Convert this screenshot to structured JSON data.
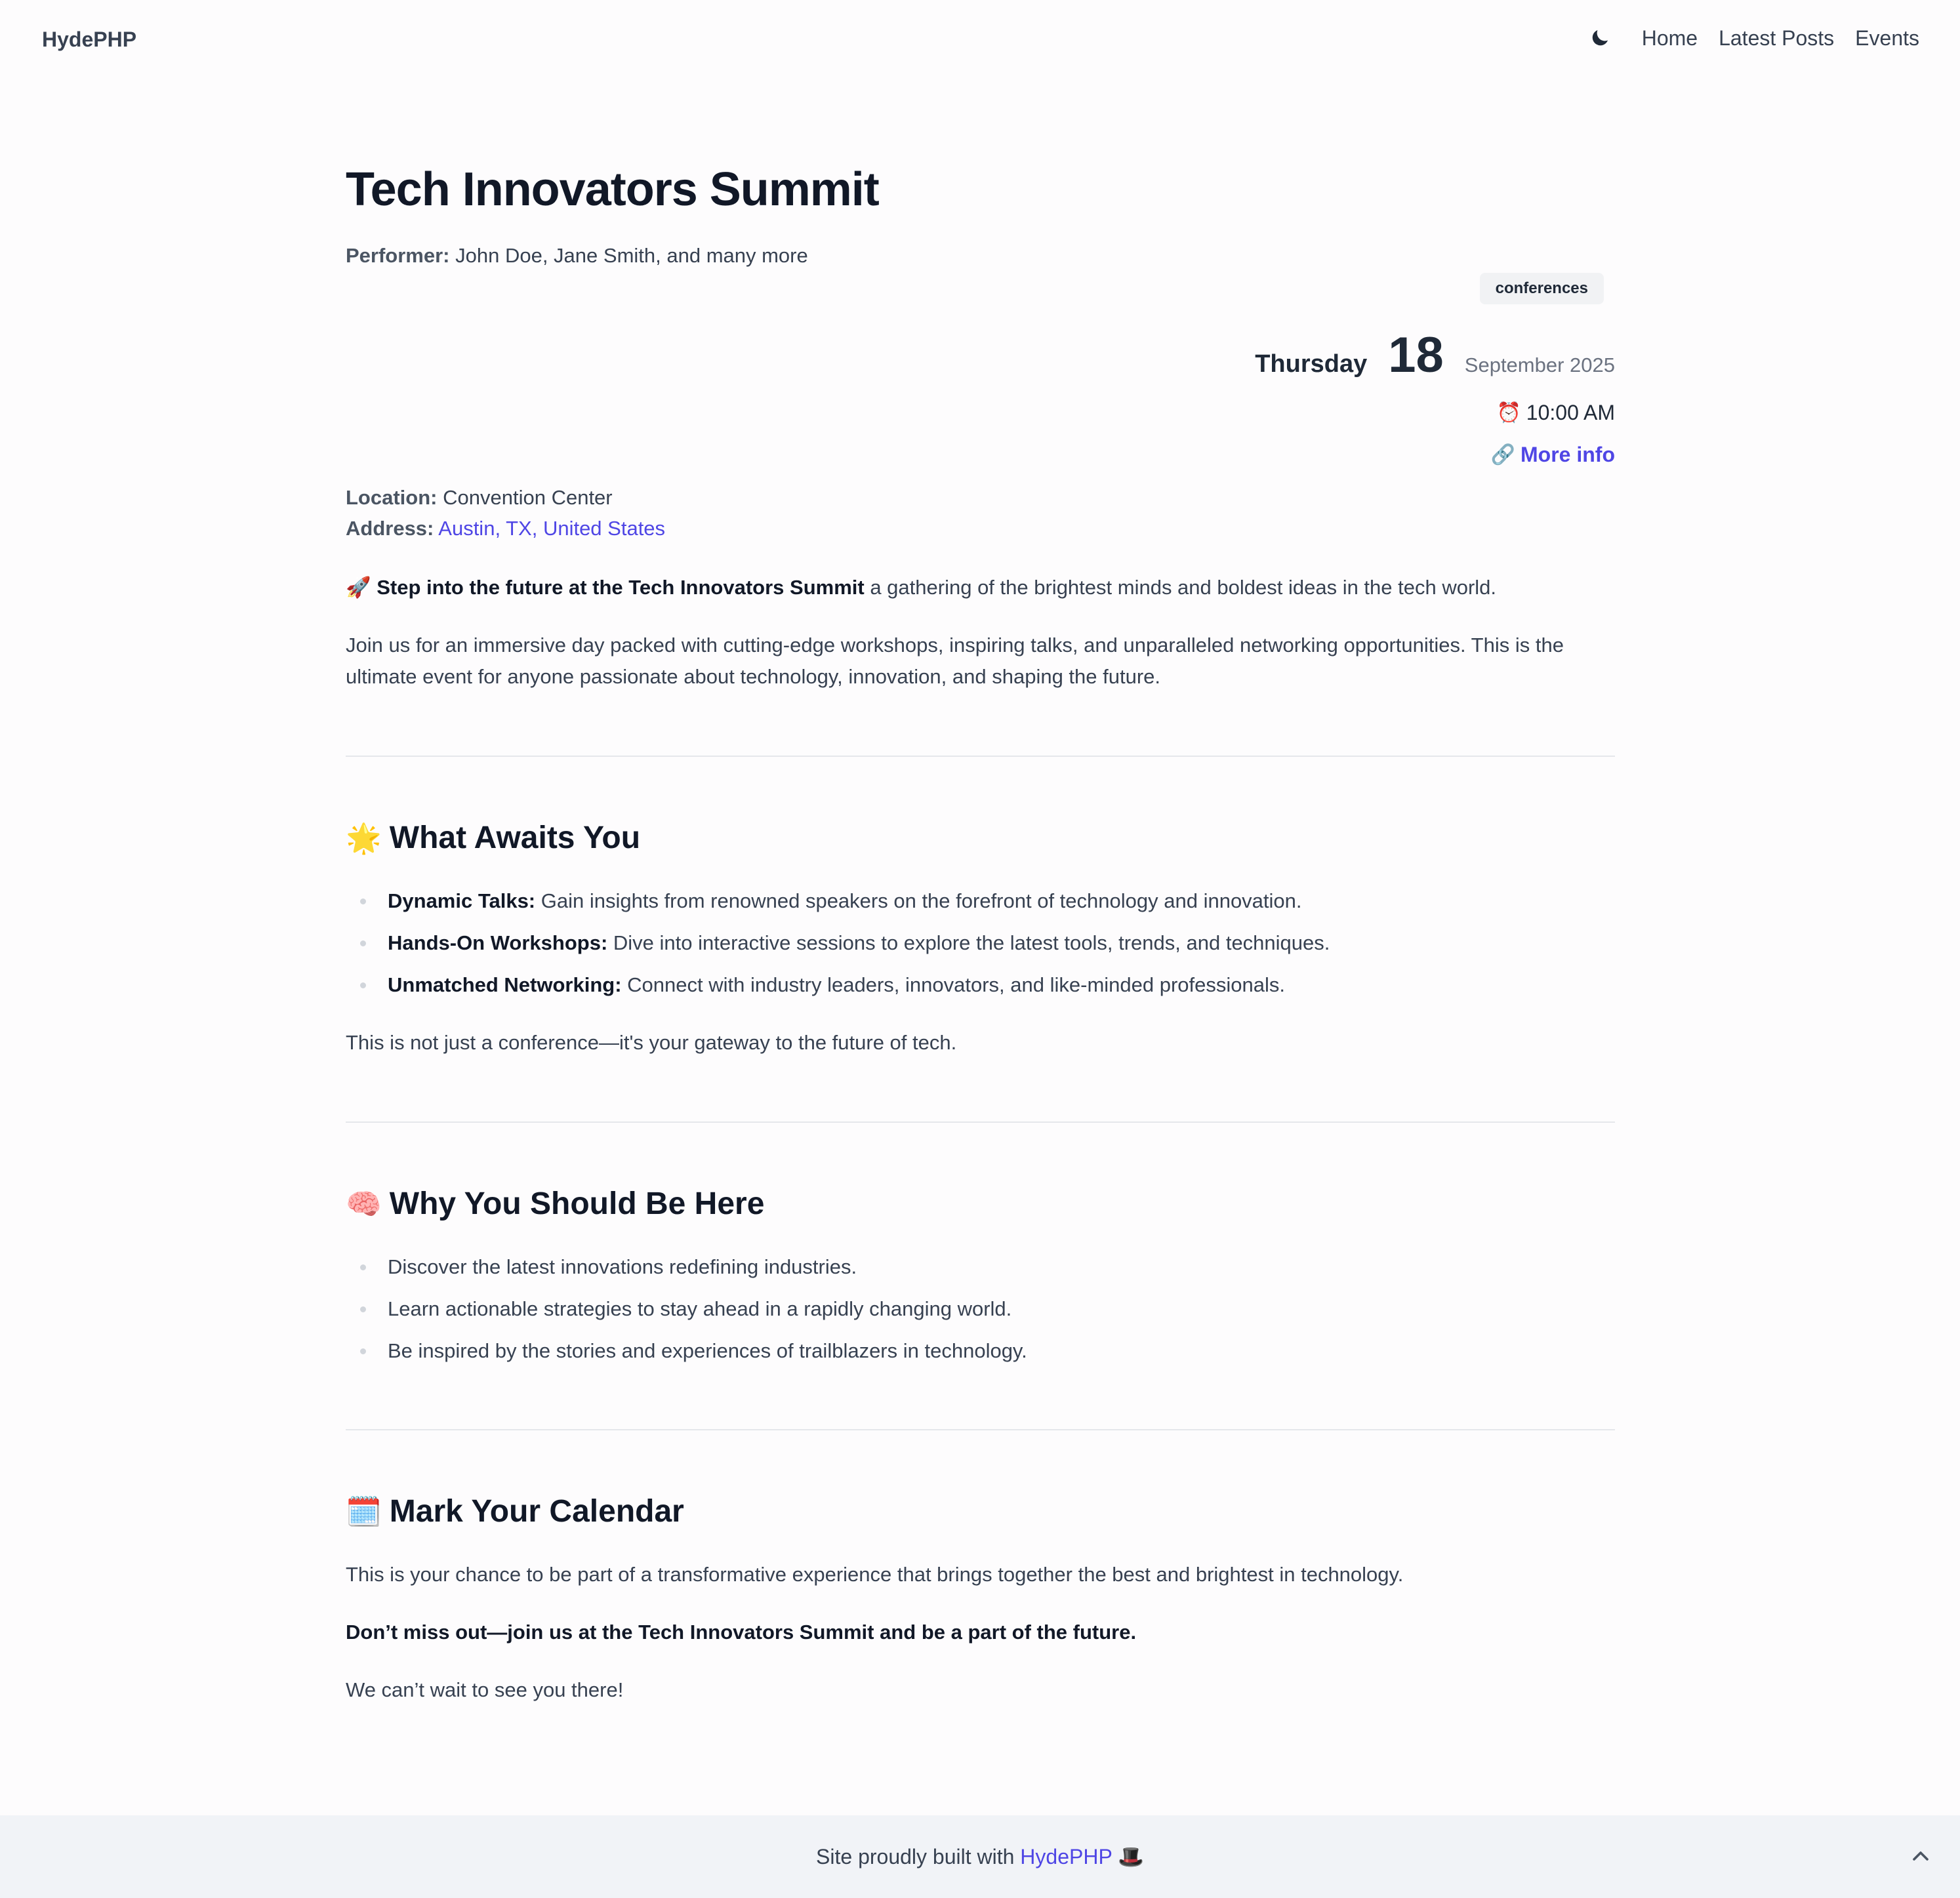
{
  "header": {
    "brand": "HydePHP",
    "nav": [
      {
        "label": "Home"
      },
      {
        "label": "Latest Posts"
      },
      {
        "label": "Events"
      }
    ],
    "theme_icon": "moon-icon"
  },
  "event": {
    "title": "Tech Innovators Summit",
    "performer_label": "Performer:",
    "performer": "John Doe, Jane Smith, and many more",
    "tag": "conferences",
    "date": {
      "weekday": "Thursday",
      "day": "18",
      "month_year": "September 2025"
    },
    "time": "10:00 AM",
    "time_icon": "⏰",
    "more_info_icon": "🔗",
    "more_info": "More info",
    "location_label": "Location:",
    "location": "Convention Center",
    "address_label": "Address:",
    "address": "Austin, TX, United States"
  },
  "content": {
    "intro_emoji": "🚀",
    "intro_bold": "Step into the future at the Tech Innovators Summit",
    "intro_rest": " a gathering of the brightest minds and boldest ideas in the tech world.",
    "intro_p2": "Join us for an immersive day packed with cutting-edge workshops, inspiring talks, and unparalleled networking opportunities. This is the ultimate event for anyone passionate about technology, innovation, and shaping the future.",
    "section1": {
      "emoji": "🌟",
      "heading": "What Awaits You",
      "items": [
        {
          "bold": "Dynamic Talks:",
          "text": " Gain insights from renowned speakers on the forefront of technology and innovation."
        },
        {
          "bold": "Hands-On Workshops:",
          "text": " Dive into interactive sessions to explore the latest tools, trends, and techniques."
        },
        {
          "bold": "Unmatched Networking:",
          "text": " Connect with industry leaders, innovators, and like-minded professionals."
        }
      ],
      "closing": "This is not just a conference—it's your gateway to the future of tech."
    },
    "section2": {
      "emoji": "🧠",
      "heading": "Why You Should Be Here",
      "items": [
        "Discover the latest innovations redefining industries.",
        "Learn actionable strategies to stay ahead in a rapidly changing world.",
        "Be inspired by the stories and experiences of trailblazers in technology."
      ]
    },
    "section3": {
      "emoji": "🗓️",
      "heading": "Mark Your Calendar",
      "p1": "This is your chance to be part of a transformative experience that brings together the best and brightest in technology.",
      "p2": "Don’t miss out—join us at the Tech Innovators Summit and be a part of the future.",
      "p3": "We can’t wait to see you there!"
    }
  },
  "footer": {
    "prefix": "Site proudly built with ",
    "link": "HydePHP",
    "emoji": "🎩",
    "back_to_top_icon": "chevron-up-icon"
  },
  "colors": {
    "accent": "#4f46e5",
    "heading": "#111827",
    "text": "#374151",
    "footer_bg": "#f1f3f7"
  }
}
